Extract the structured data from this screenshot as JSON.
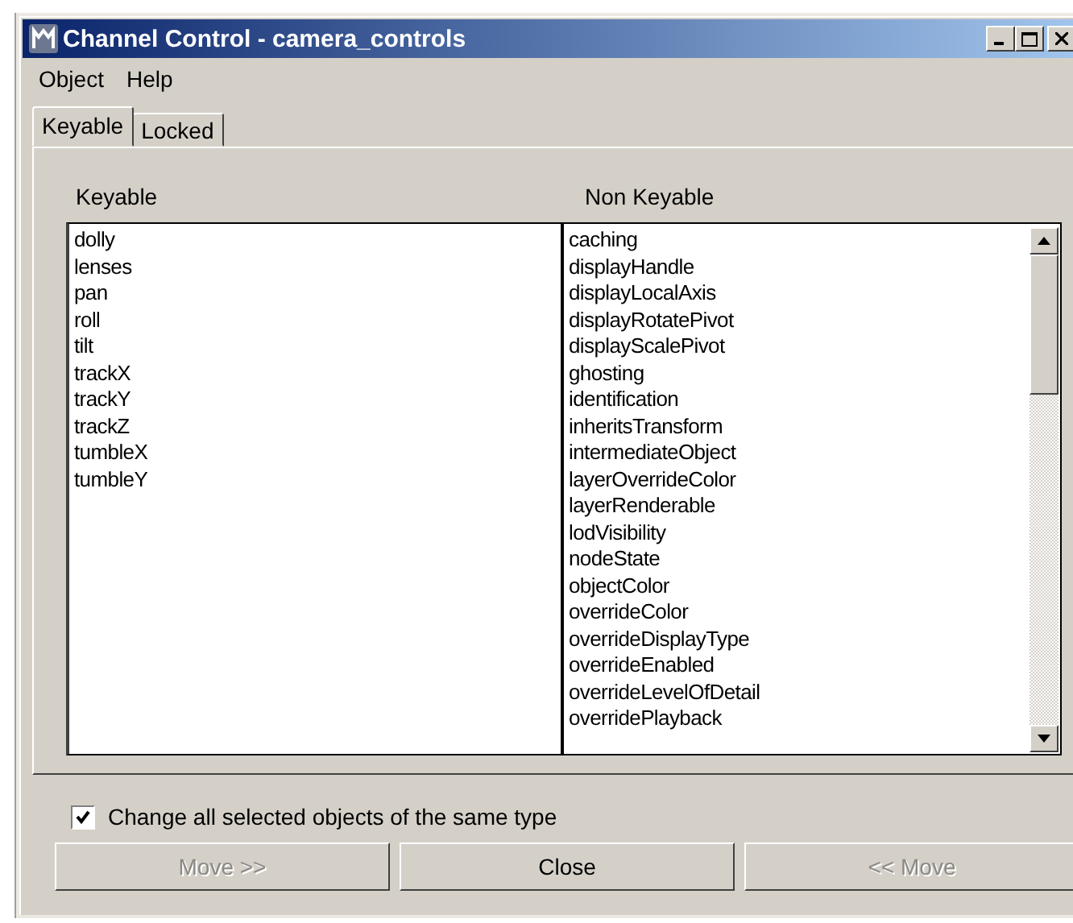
{
  "window": {
    "title": "Channel Control - camera_controls"
  },
  "menu": [
    "Object",
    "Help"
  ],
  "tabs": [
    {
      "label": "Keyable",
      "selected": true
    },
    {
      "label": "Locked",
      "selected": false
    }
  ],
  "keyable": {
    "heading": "Keyable",
    "items": [
      "dolly",
      "lenses",
      "pan",
      "roll",
      "tilt",
      "trackX",
      "trackY",
      "trackZ",
      "tumbleX",
      "tumbleY"
    ]
  },
  "non_keyable": {
    "heading": "Non Keyable",
    "items": [
      "caching",
      "displayHandle",
      "displayLocalAxis",
      "displayRotatePivot",
      "displayScalePivot",
      "ghosting",
      "identification",
      "inheritsTransform",
      "intermediateObject",
      "layerOverrideColor",
      "layerRenderable",
      "lodVisibility",
      "nodeState",
      "objectColor",
      "overrideColor",
      "overrideDisplayType",
      "overrideEnabled",
      "overrideLevelOfDetail",
      "overridePlayback"
    ]
  },
  "option": {
    "label": "Change all selected objects of the same type",
    "checked": true
  },
  "buttons": [
    {
      "label": "Move >>",
      "disabled": true
    },
    {
      "label": "Close",
      "disabled": false
    },
    {
      "label": "<< Move",
      "disabled": true
    }
  ]
}
